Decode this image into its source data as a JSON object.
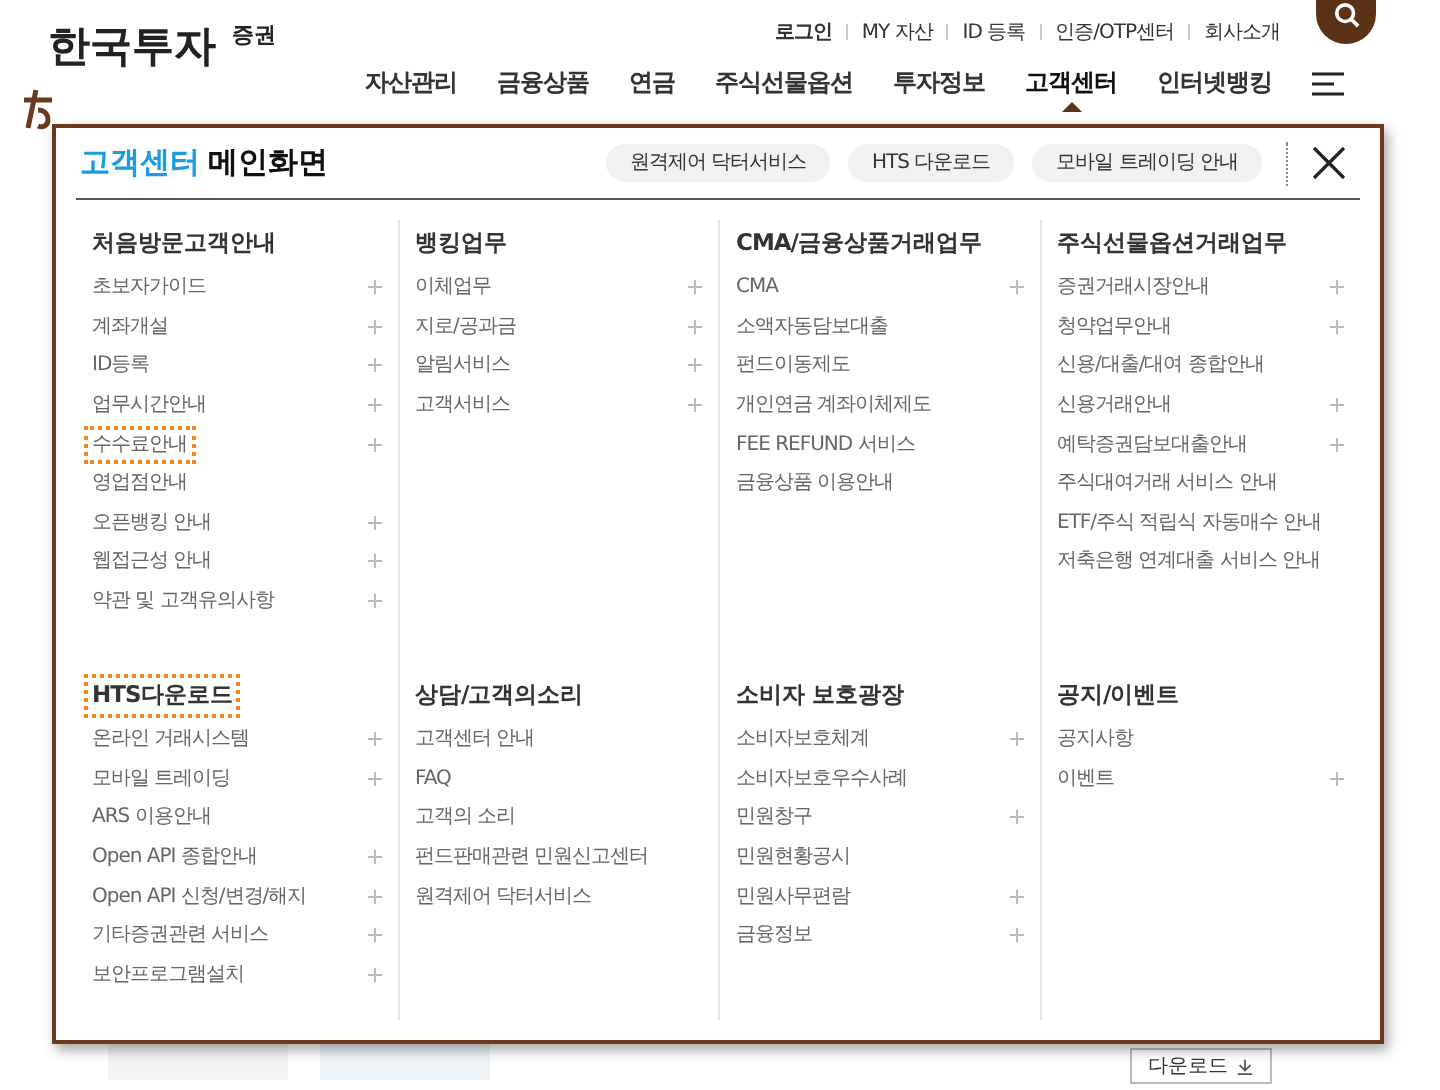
{
  "logo": {
    "name": "한국투자",
    "suffix": "증권"
  },
  "top_links": [
    "로그인",
    "MY 자산",
    "ID 등록",
    "인증/OTP센터",
    "회사소개"
  ],
  "nav": [
    {
      "label": "자산관리",
      "selected": false
    },
    {
      "label": "금융상품",
      "selected": false
    },
    {
      "label": "연금",
      "selected": false
    },
    {
      "label": "주식선물옵션",
      "selected": false
    },
    {
      "label": "투자정보",
      "selected": false
    },
    {
      "label": "고객센터",
      "selected": true
    },
    {
      "label": "인터넷뱅킹",
      "selected": false
    }
  ],
  "panel": {
    "title_highlight": "고객센터",
    "title": "메인화면",
    "quick_buttons": [
      "원격제어 닥터서비스",
      "HTS 다운로드",
      "모바일 트레이딩 안내"
    ],
    "sections": [
      {
        "title": "처음방문고객안내",
        "focused": false,
        "items": [
          {
            "label": "초보자가이드",
            "expandable": true,
            "focused": false
          },
          {
            "label": "계좌개설",
            "expandable": true,
            "focused": false
          },
          {
            "label": "ID등록",
            "expandable": true,
            "focused": false
          },
          {
            "label": "업무시간안내",
            "expandable": true,
            "focused": false
          },
          {
            "label": "수수료안내",
            "expandable": true,
            "focused": true
          },
          {
            "label": "영업점안내",
            "expandable": false,
            "focused": false
          },
          {
            "label": "오픈뱅킹 안내",
            "expandable": true,
            "focused": false
          },
          {
            "label": "웹접근성 안내",
            "expandable": true,
            "focused": false
          },
          {
            "label": "약관 및 고객유의사항",
            "expandable": true,
            "focused": false
          }
        ]
      },
      {
        "title": "뱅킹업무",
        "focused": false,
        "items": [
          {
            "label": "이체업무",
            "expandable": true,
            "focused": false
          },
          {
            "label": "지로/공과금",
            "expandable": true,
            "focused": false
          },
          {
            "label": "알림서비스",
            "expandable": true,
            "focused": false
          },
          {
            "label": "고객서비스",
            "expandable": true,
            "focused": false
          }
        ]
      },
      {
        "title": "CMA/금융상품거래업무",
        "focused": false,
        "items": [
          {
            "label": "CMA",
            "expandable": true,
            "focused": false
          },
          {
            "label": "소액자동담보대출",
            "expandable": false,
            "focused": false
          },
          {
            "label": "펀드이동제도",
            "expandable": false,
            "focused": false
          },
          {
            "label": "개인연금 계좌이체제도",
            "expandable": false,
            "focused": false
          },
          {
            "label": "FEE REFUND 서비스",
            "expandable": false,
            "focused": false
          },
          {
            "label": "금융상품 이용안내",
            "expandable": false,
            "focused": false
          }
        ]
      },
      {
        "title": "주식선물옵션거래업무",
        "focused": false,
        "items": [
          {
            "label": "증권거래시장안내",
            "expandable": true,
            "focused": false
          },
          {
            "label": "청약업무안내",
            "expandable": true,
            "focused": false
          },
          {
            "label": "신용/대출/대여 종합안내",
            "expandable": false,
            "focused": false
          },
          {
            "label": "신용거래안내",
            "expandable": true,
            "focused": false
          },
          {
            "label": "예탁증권담보대출안내",
            "expandable": true,
            "focused": false
          },
          {
            "label": "주식대여거래 서비스 안내",
            "expandable": false,
            "focused": false
          },
          {
            "label": "ETF/주식 적립식 자동매수 안내",
            "expandable": false,
            "focused": false
          },
          {
            "label": "저축은행 연계대출 서비스 안내",
            "expandable": false,
            "focused": false
          }
        ]
      },
      {
        "title": "HTS다운로드",
        "focused": true,
        "items": [
          {
            "label": "온라인 거래시스템",
            "expandable": true,
            "focused": false
          },
          {
            "label": "모바일 트레이딩",
            "expandable": true,
            "focused": false
          },
          {
            "label": "ARS 이용안내",
            "expandable": false,
            "focused": false
          },
          {
            "label": "Open API 종합안내",
            "expandable": true,
            "focused": false
          },
          {
            "label": "Open API 신청/변경/해지",
            "expandable": true,
            "focused": false
          },
          {
            "label": "기타증권관련 서비스",
            "expandable": true,
            "focused": false
          },
          {
            "label": "보안프로그램설치",
            "expandable": true,
            "focused": false
          }
        ]
      },
      {
        "title": "상담/고객의소리",
        "focused": false,
        "items": [
          {
            "label": "고객센터 안내",
            "expandable": false,
            "focused": false
          },
          {
            "label": "FAQ",
            "expandable": false,
            "focused": false
          },
          {
            "label": "고객의 소리",
            "expandable": false,
            "focused": false
          },
          {
            "label": "펀드판매관련 민원신고센터",
            "expandable": false,
            "focused": false
          },
          {
            "label": "원격제어 닥터서비스",
            "expandable": false,
            "focused": false
          }
        ]
      },
      {
        "title": "소비자 보호광장",
        "focused": false,
        "items": [
          {
            "label": "소비자보호체계",
            "expandable": true,
            "focused": false
          },
          {
            "label": "소비자보호우수사례",
            "expandable": false,
            "focused": false
          },
          {
            "label": "민원창구",
            "expandable": true,
            "focused": false
          },
          {
            "label": "민원현황공시",
            "expandable": false,
            "focused": false
          },
          {
            "label": "민원사무편람",
            "expandable": true,
            "focused": false
          },
          {
            "label": "금융정보",
            "expandable": true,
            "focused": false
          }
        ]
      },
      {
        "title": "공지/이벤트",
        "focused": false,
        "items": [
          {
            "label": "공지사항",
            "expandable": false,
            "focused": false
          },
          {
            "label": "이벤트",
            "expandable": true,
            "focused": false
          }
        ]
      }
    ]
  },
  "page": {
    "download_button": "다운로드"
  }
}
